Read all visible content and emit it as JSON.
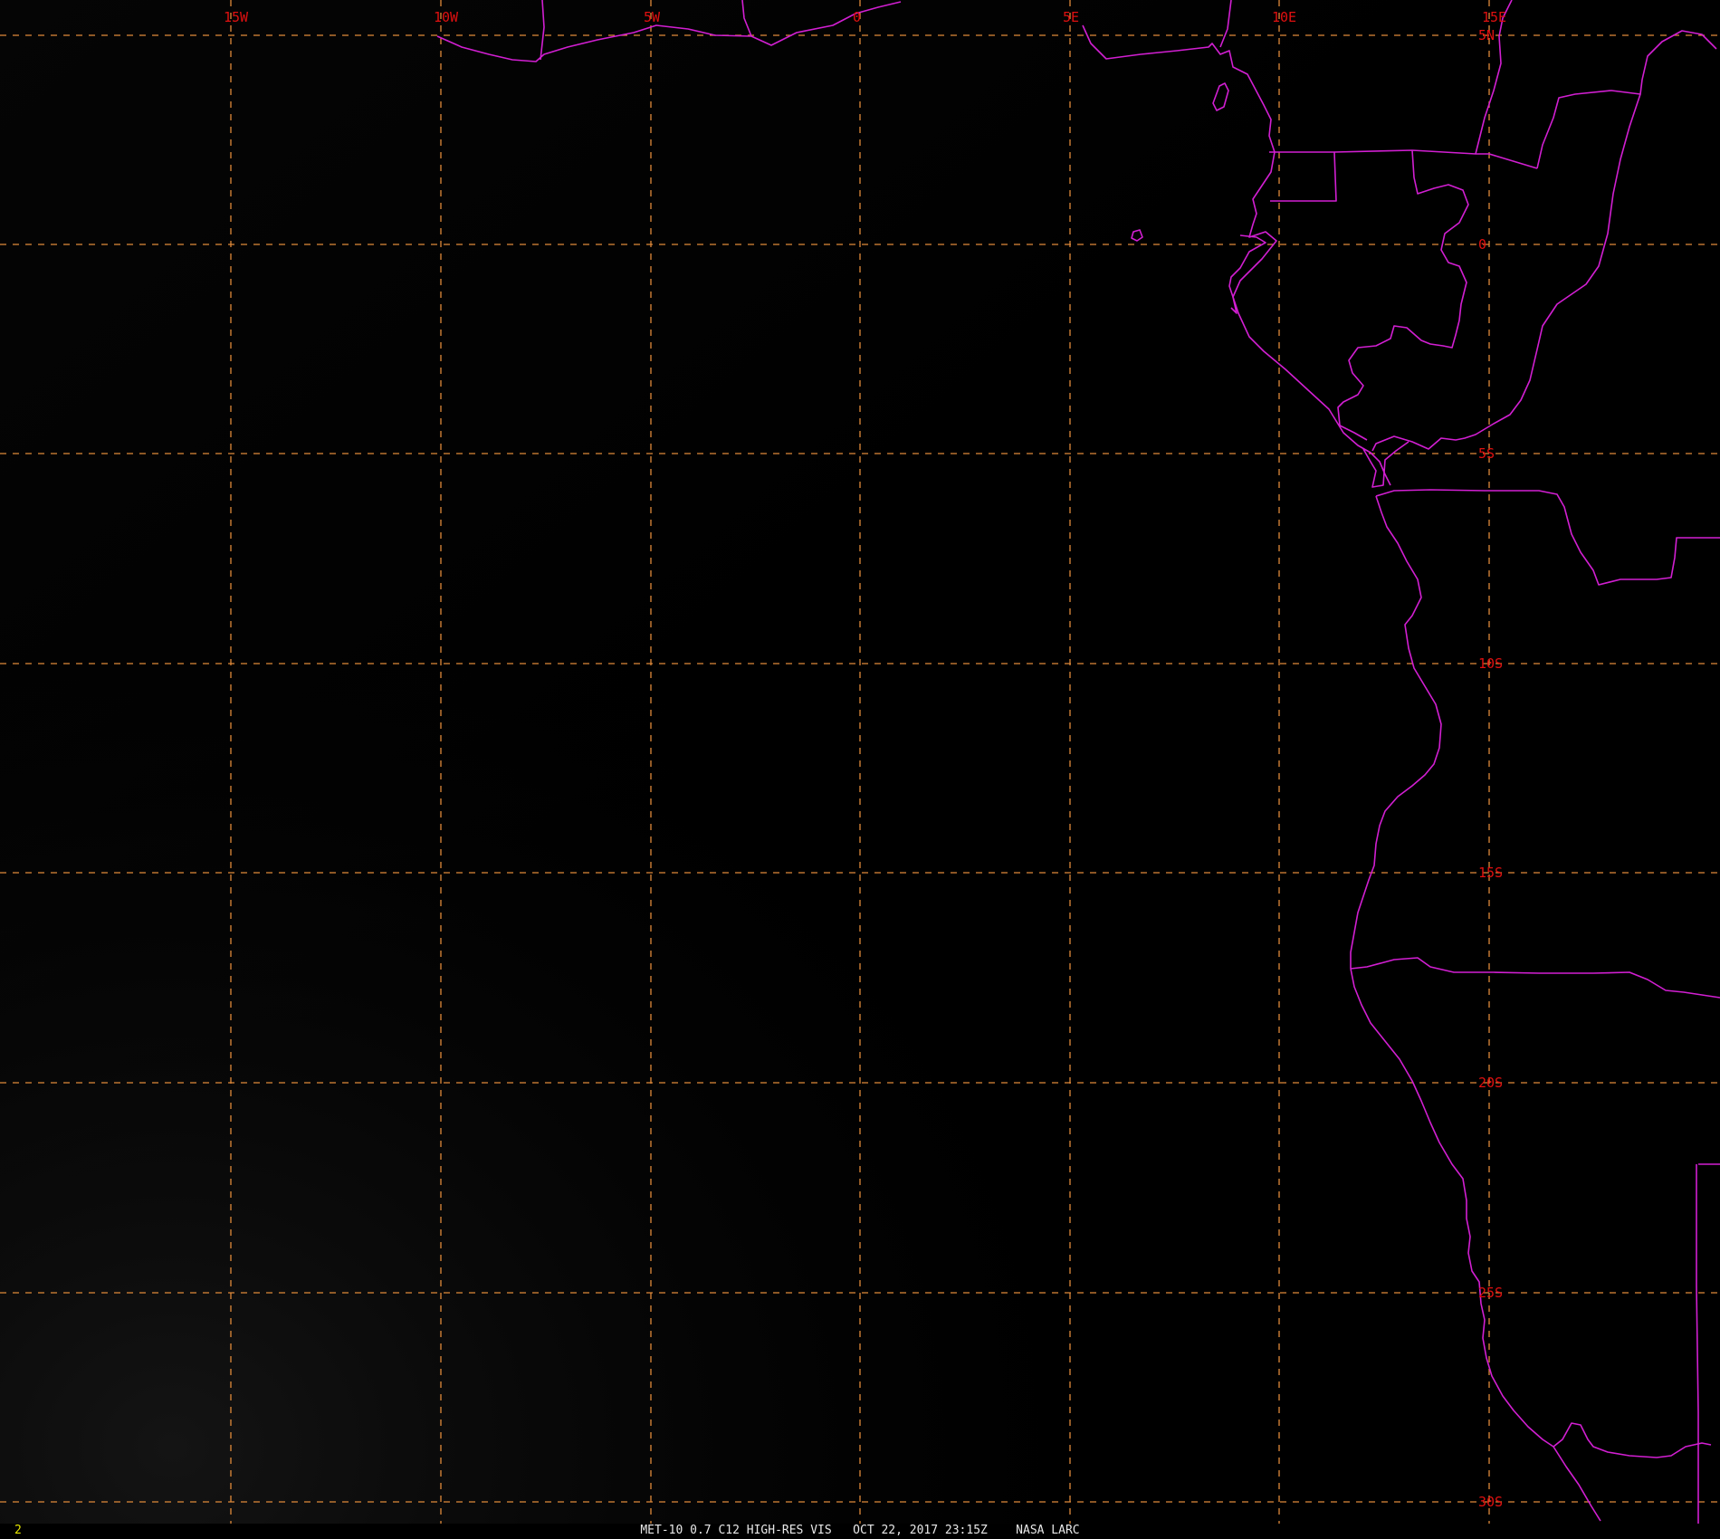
{
  "window": {
    "caption": "MET-10 0.7 C12 HIGH-RES VIS   OCT 22, 2017 23:15Z    NASA LARC",
    "frame_number": "2"
  },
  "colors": {
    "background": "#000000",
    "grid": "#e08a3a",
    "grid_label": "#e01010",
    "coastline": "#d21fd2",
    "frame_number": "#e6e600",
    "caption": "#e8e8e8"
  },
  "map": {
    "projection": "satellite visible channel",
    "grid_spacing_deg": 5,
    "longitude_labels": [
      "15W",
      "10W",
      "5W",
      "0",
      "5E",
      "10E",
      "15E"
    ],
    "latitude_labels": [
      "5N",
      "0",
      "5S",
      "10S",
      "15S",
      "20S",
      "25S",
      "30S"
    ],
    "overlays": [
      "coastline",
      "country-borders",
      "lat-lon-grid"
    ]
  }
}
